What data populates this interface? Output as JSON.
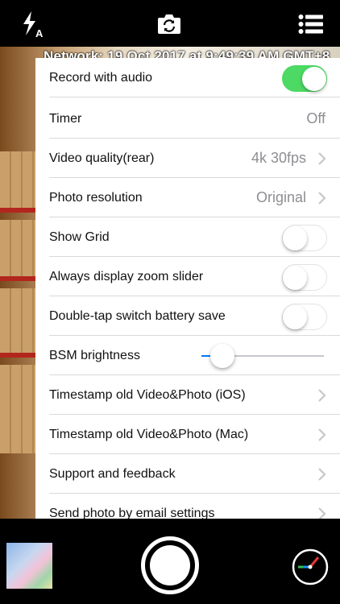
{
  "overlay": {
    "timestamp": "Network: 19 Oct 2017 at 9:49:39 AM GMT+8"
  },
  "settings": {
    "record_audio": {
      "label": "Record with audio",
      "enabled": true
    },
    "timer": {
      "label": "Timer",
      "value": "Off"
    },
    "video_quality": {
      "label": "Video quality(rear)",
      "value": "4k 30fps"
    },
    "photo_resolution": {
      "label": "Photo resolution",
      "value": "Original"
    },
    "show_grid": {
      "label": "Show Grid",
      "enabled": false
    },
    "zoom_slider": {
      "label": "Always display zoom slider",
      "enabled": false
    },
    "battery_save": {
      "label": "Double-tap switch battery save",
      "enabled": false
    },
    "bsm_brightness": {
      "label": "BSM brightness",
      "level": 0.17
    },
    "timestamp_ios": {
      "label": "Timestamp old Video&Photo (iOS)"
    },
    "timestamp_mac": {
      "label": "Timestamp old Video&Photo (Mac)"
    },
    "support": {
      "label": "Support and feedback"
    },
    "email_settings": {
      "label": "Send photo by email settings"
    }
  },
  "icons": {
    "flash": "flash-auto-icon",
    "camera_switch": "camera-switch-icon",
    "menu": "menu-list-icon",
    "shutter": "shutter-icon",
    "gauge": "gauge-icon"
  },
  "colors": {
    "toggle_on": "#4cd964",
    "slider": "#007aff",
    "chevron": "#c7c7cc"
  }
}
